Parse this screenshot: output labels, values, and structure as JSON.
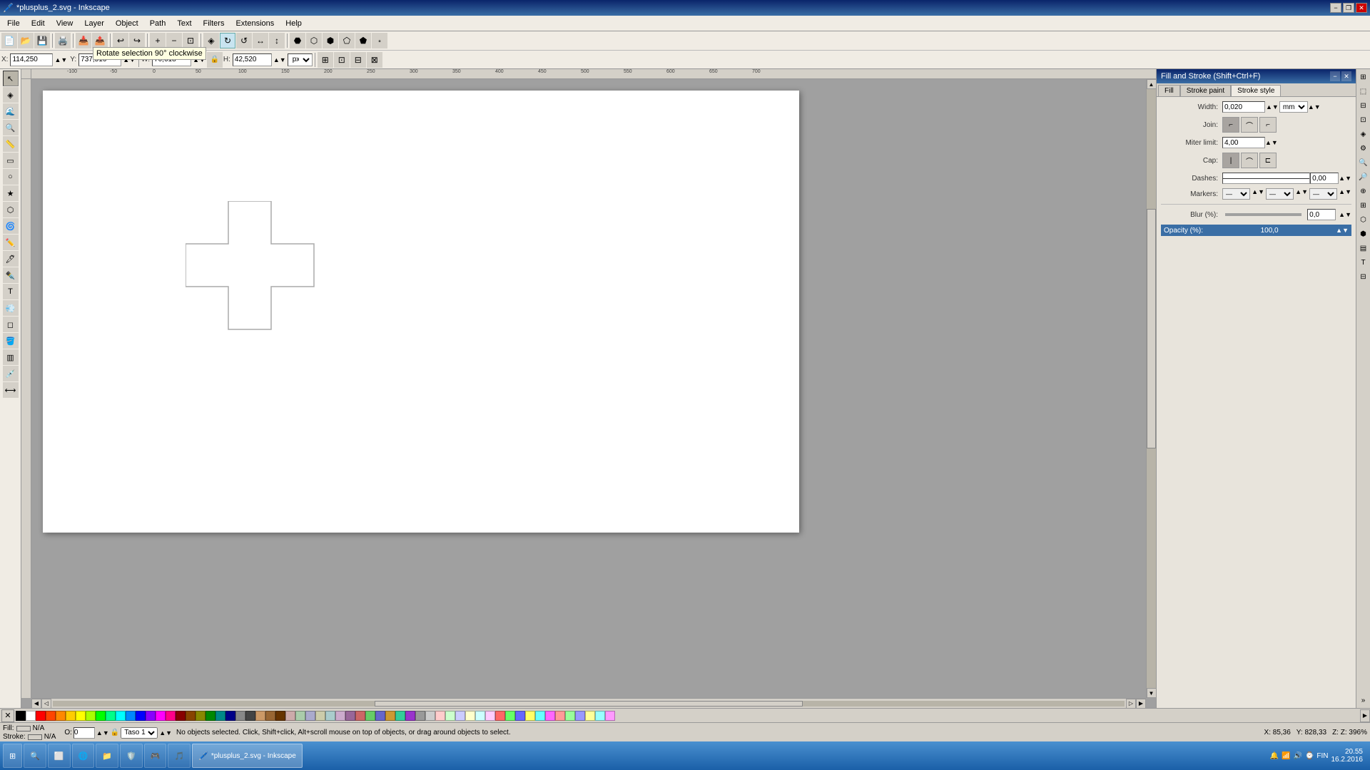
{
  "titlebar": {
    "title": "*plusplus_2.svg - Inkscape",
    "min": "−",
    "restore": "❐",
    "close": "✕"
  },
  "menu": {
    "items": [
      "File",
      "Edit",
      "View",
      "Layer",
      "Object",
      "Path",
      "Text",
      "Filters",
      "Extensions",
      "Help"
    ]
  },
  "toolbar": {
    "tooltip": "Rotate selection 90° clockwise",
    "x_label": "X:",
    "x_value": "114,250",
    "y_label": "Y:",
    "y_value": "737,516",
    "w_label": "W:",
    "w_value": "70,618",
    "h_label": "H:",
    "h_value": "42,520",
    "unit": "px"
  },
  "fill_stroke_panel": {
    "title": "Fill and Stroke (Shift+Ctrl+F)",
    "tabs": [
      "Fill",
      "Stroke paint",
      "Stroke style"
    ],
    "active_tab": "Stroke style",
    "width_label": "Width:",
    "width_value": "0,020",
    "width_unit": "mm",
    "join_label": "Join:",
    "miter_label": "Miter limit:",
    "miter_value": "4,00",
    "cap_label": "Cap:",
    "dashes_label": "Dashes:",
    "dashes_value": "0,00",
    "markers_label": "Markers:",
    "blur_label": "Blur (%):",
    "blur_value": "0,0",
    "opacity_label": "Opacity (%):",
    "opacity_value": "100,0"
  },
  "status": {
    "fill_label": "Fill:",
    "fill_value": "N/A",
    "stroke_label": "Stroke:",
    "stroke_value": "N/A",
    "opacity_label": "O:",
    "opacity_value": "0",
    "layer": "Taso 1",
    "message": "No objects selected. Click, Shift+click, Alt+scroll mouse on top of objects, or drag around objects to select.",
    "x": "85,36",
    "y": "828,33",
    "zoom": "396%",
    "coords_label": "X: 85,36\nY: 828,33",
    "zoom_display": "Z: 396%"
  },
  "taskbar": {
    "start": "⊞",
    "apps": [
      "🔍",
      "⬜",
      "🌐",
      "📁",
      "🛡️",
      "🎮",
      "🎵"
    ],
    "active_app": "*plusplus_2.svg - Inkscape",
    "time": "20.55",
    "date": "16.2.2016",
    "language": "FIN"
  },
  "colors": {
    "swatches": [
      "#000000",
      "#ffffff",
      "#ff0000",
      "#ff4400",
      "#ff8800",
      "#ffcc00",
      "#ffff00",
      "#aaff00",
      "#00ff00",
      "#00ff88",
      "#00ffff",
      "#0088ff",
      "#0000ff",
      "#8800ff",
      "#ff00ff",
      "#ff0088",
      "#880000",
      "#884400",
      "#888800",
      "#008800",
      "#008888",
      "#000088",
      "#888888",
      "#444444",
      "#cc9966",
      "#996633",
      "#663300",
      "#ccaaaa",
      "#aaccaa",
      "#aaaacc",
      "#ccccaa",
      "#aacccc",
      "#ccaacc",
      "#996699",
      "#cc6666",
      "#66cc66",
      "#6666cc",
      "#cc9933",
      "#33cc99",
      "#9933cc",
      "#999999",
      "#cccccc",
      "#ffcccc",
      "#ccffcc",
      "#ccccff",
      "#ffffcc",
      "#ccffff",
      "#ffccff",
      "#ff6666",
      "#66ff66",
      "#6666ff",
      "#ffff66",
      "#66ffff",
      "#ff66ff",
      "#ff9999",
      "#99ff99",
      "#9999ff",
      "#ffff99",
      "#99ffff",
      "#ff99ff"
    ]
  }
}
